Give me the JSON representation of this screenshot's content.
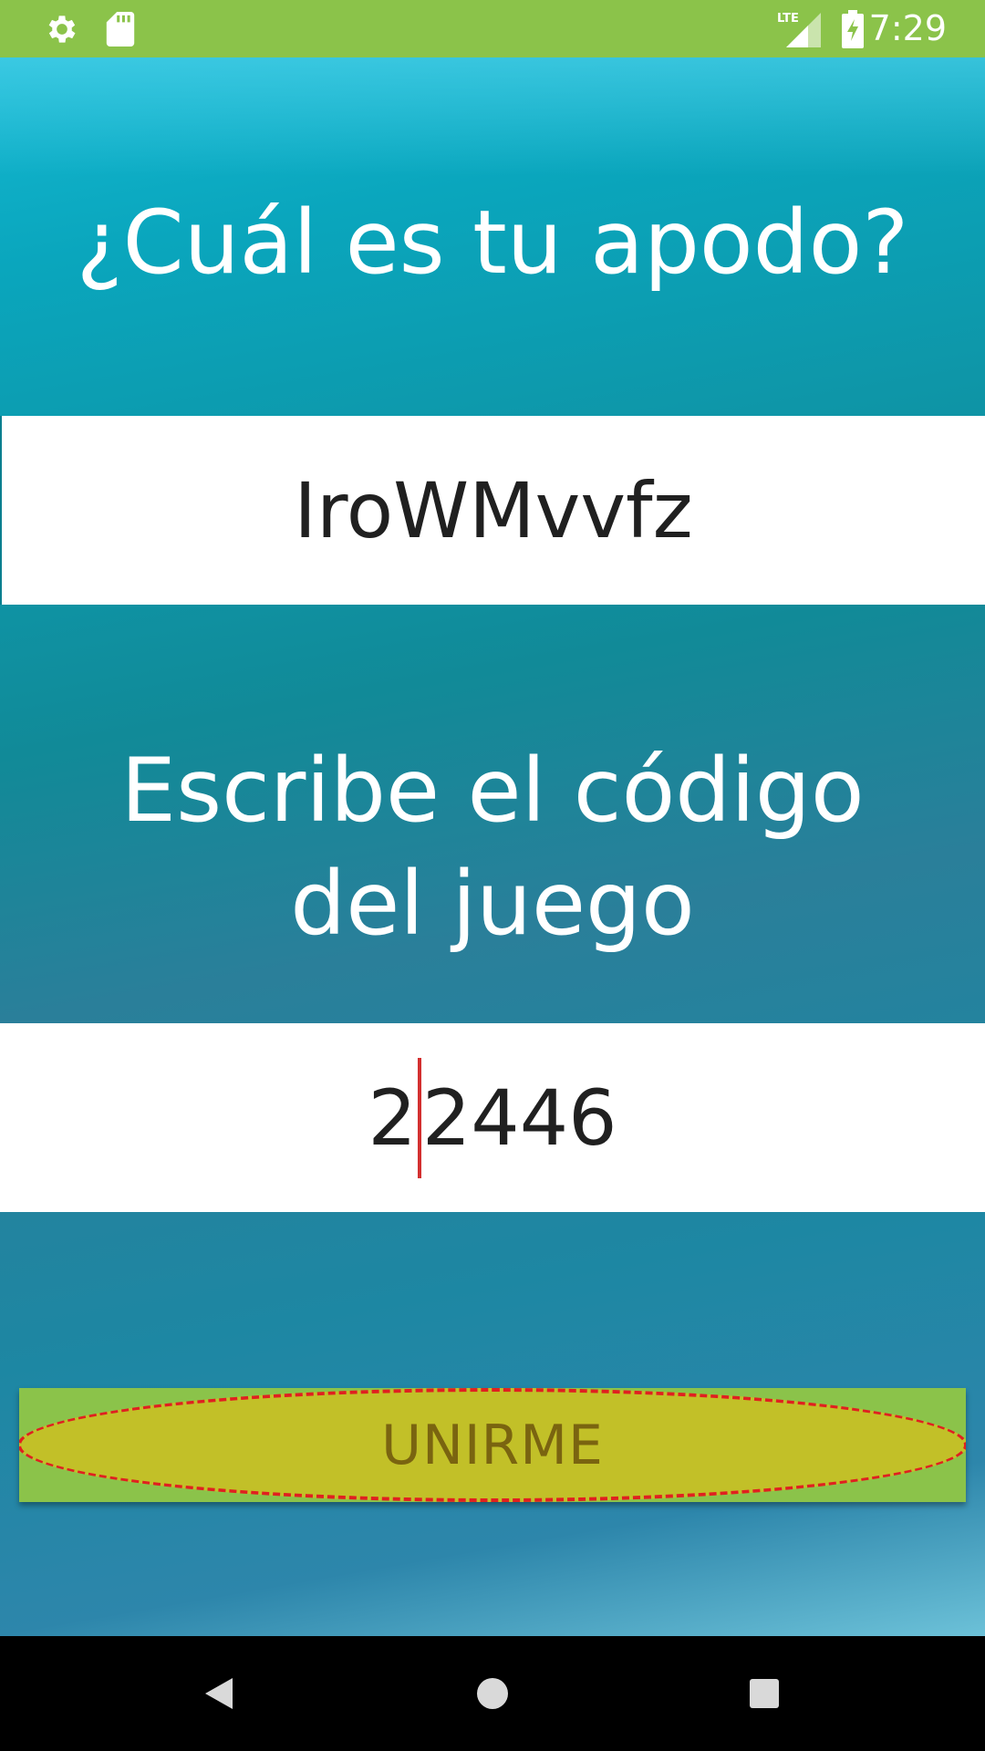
{
  "status_bar": {
    "time": "7:29",
    "network": "LTE",
    "icons": [
      "settings-icon",
      "sd-card-icon",
      "lte-signal-icon",
      "battery-charging-icon"
    ]
  },
  "nickname": {
    "heading": "¿Cuál es tu apodo?",
    "value": "IroWMvvfz"
  },
  "game_code": {
    "heading": "Escribe el código del juego",
    "value_before_caret": "2",
    "value_after_caret": "2446"
  },
  "join_button": {
    "label": "UNIRME"
  },
  "nav_bar": {
    "icons": [
      "back-icon",
      "home-icon",
      "recents-icon"
    ]
  },
  "colors": {
    "status_bar": "#8bc34a",
    "button_bg": "#8bc34a",
    "button_oval": "#c2c028",
    "button_text": "#7a6410",
    "highlight_dash": "#e02020",
    "caret": "#d32f2f"
  }
}
